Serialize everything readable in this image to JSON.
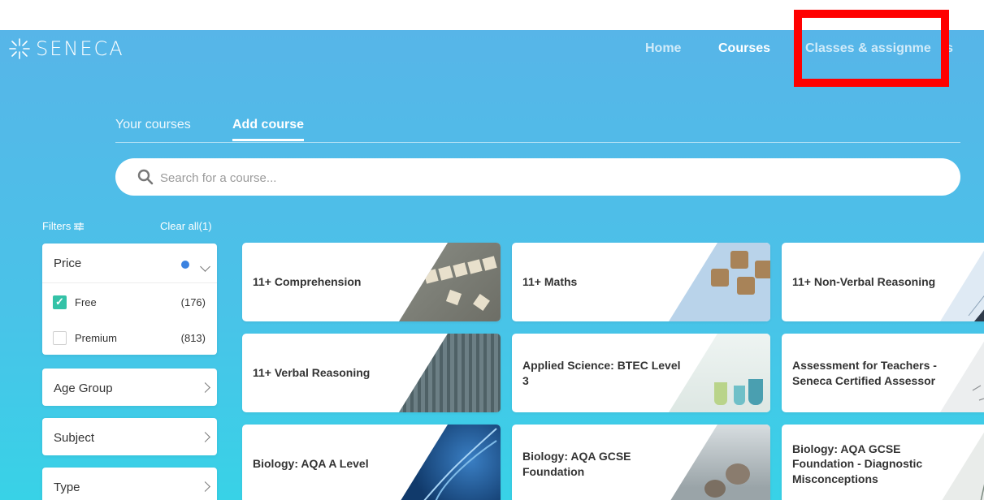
{
  "brand": {
    "name": "SENECA"
  },
  "nav": {
    "home": "Home",
    "courses": "Courses",
    "classes": "Classes & assignme",
    "classes_tail": "ts"
  },
  "tabs": {
    "your_courses": "Your courses",
    "add_course": "Add course"
  },
  "search": {
    "placeholder": "Search for a course..."
  },
  "filters": {
    "label": "Filters",
    "clear_all": "Clear all(1)",
    "price": {
      "label": "Price",
      "options": [
        {
          "label": "Free",
          "count": "(176)",
          "checked": true
        },
        {
          "label": "Premium",
          "count": "(813)",
          "checked": false
        }
      ]
    },
    "age_group": "Age Group",
    "subject": "Subject",
    "type": "Type"
  },
  "courses": [
    {
      "title": "11+ Comprehension",
      "image": "scrabble-tiles-reading"
    },
    {
      "title": "11+ Maths",
      "image": "number-dice"
    },
    {
      "title": "11+ Non-Verbal Reasoning",
      "image": "shapes-diagram"
    },
    {
      "title": "11+ Verbal Reasoning",
      "image": "letter-blocks-aerial"
    },
    {
      "title": "Applied Science: BTEC Level 3",
      "image": "lab-flasks"
    },
    {
      "title": "Assessment for Teachers - Seneca Certified Assessor",
      "image": "math-paper"
    },
    {
      "title": "Biology: AQA A Level",
      "image": "dna-helix"
    },
    {
      "title": "Biology: AQA GCSE Foundation",
      "image": "snow-monkeys"
    },
    {
      "title": "Biology: AQA GCSE Foundation - Diagnostic Misconceptions",
      "image": "plant-sketch"
    }
  ],
  "colors": {
    "accent": "#3b82e0",
    "check": "#34c2a7",
    "annotation": "#ff0000"
  }
}
